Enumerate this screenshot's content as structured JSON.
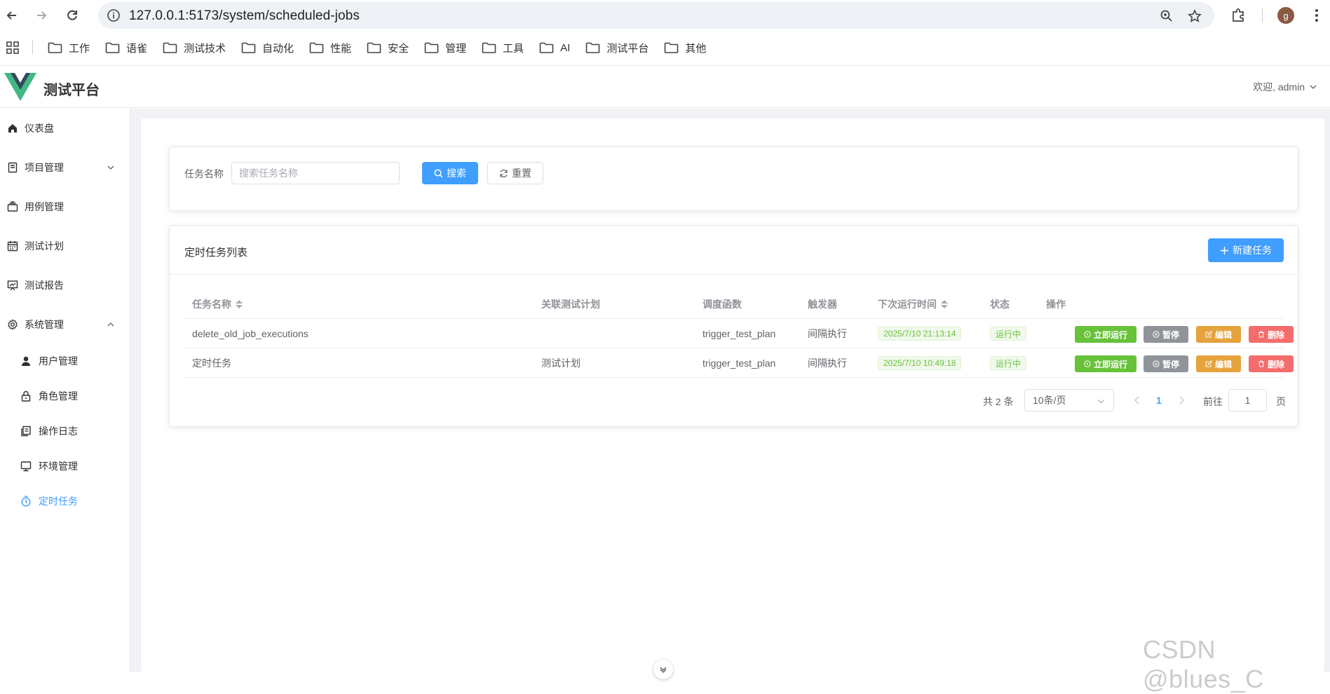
{
  "browser": {
    "url": "127.0.0.1:5173/system/scheduled-jobs",
    "profile_initial": "g",
    "bookmarks": [
      "工作",
      "语雀",
      "测试技术",
      "自动化",
      "性能",
      "安全",
      "管理",
      "工具",
      "AI",
      "测试平台",
      "其他"
    ]
  },
  "app": {
    "title": "测试平台",
    "welcome": "欢迎, admin",
    "accent_color": "#409eff"
  },
  "sidebar": {
    "items": [
      {
        "label": "仪表盘",
        "icon": "home-icon"
      },
      {
        "label": "项目管理",
        "icon": "project-icon",
        "expandable": true,
        "expanded": false
      },
      {
        "label": "用例管理",
        "icon": "case-icon"
      },
      {
        "label": "测试计划",
        "icon": "calendar-icon"
      },
      {
        "label": "测试报告",
        "icon": "report-icon"
      },
      {
        "label": "系统管理",
        "icon": "gear-icon",
        "expandable": true,
        "expanded": true
      }
    ],
    "subitems": [
      {
        "label": "用户管理",
        "icon": "user-icon"
      },
      {
        "label": "角色管理",
        "icon": "lock-icon"
      },
      {
        "label": "操作日志",
        "icon": "log-icon"
      },
      {
        "label": "环境管理",
        "icon": "monitor-icon"
      },
      {
        "label": "定时任务",
        "icon": "timer-icon",
        "active": true
      }
    ]
  },
  "search": {
    "label": "任务名称",
    "placeholder": "搜索任务名称",
    "search_button": "搜索",
    "reset_button": "重置"
  },
  "list": {
    "title": "定时任务列表",
    "new_button": "新建任务",
    "columns": [
      "任务名称",
      "关联测试计划",
      "调度函数",
      "触发器",
      "下次运行时间",
      "状态",
      "操作"
    ],
    "rows": [
      {
        "name": "delete_old_job_executions",
        "plan": "",
        "func": "trigger_test_plan",
        "trigger": "间隔执行",
        "next_run": "2025/7/10 21:13:14",
        "status": "运行中"
      },
      {
        "name": "定时任务",
        "plan": "测试计划",
        "func": "trigger_test_plan",
        "trigger": "间隔执行",
        "next_run": "2025/7/10 10:49:18",
        "status": "运行中"
      }
    ],
    "actions": {
      "run": "立即运行",
      "pause": "暂停",
      "edit": "编辑",
      "delete": "删除"
    }
  },
  "pagination": {
    "total": "共 2 条",
    "page_size": "10条/页",
    "current_page": "1",
    "goto_label": "前往",
    "goto_value": "1",
    "page_suffix": "页"
  },
  "watermark": "CSDN @blues_C"
}
